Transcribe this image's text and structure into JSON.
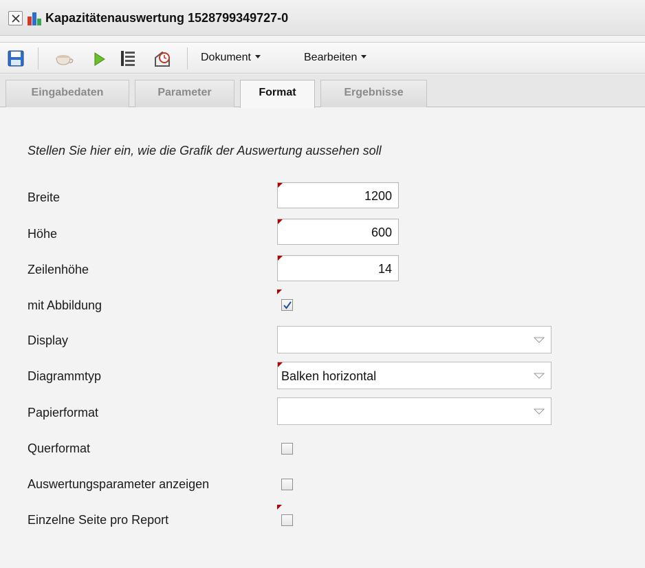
{
  "window": {
    "title": "Kapazitätenauswertung 1528799349727-0"
  },
  "toolbar": {
    "menus": [
      "Dokument",
      "Bearbeiten"
    ]
  },
  "tabs": [
    {
      "label": "Eingabedaten"
    },
    {
      "label": "Parameter"
    },
    {
      "label": "Format"
    },
    {
      "label": "Ergebnisse"
    }
  ],
  "active_tab": "Format",
  "form": {
    "intro": "Stellen Sie hier ein, wie die Grafik der Auswertung aussehen soll",
    "breite": {
      "label": "Breite",
      "value": "1200"
    },
    "hoehe": {
      "label": "Höhe",
      "value": "600"
    },
    "zeilenhoehe": {
      "label": "Zeilenhöhe",
      "value": "14"
    },
    "mit_abbildung": {
      "label": "mit Abbildung",
      "checked": true
    },
    "display": {
      "label": "Display",
      "value": ""
    },
    "diagrammtyp": {
      "label": "Diagrammtyp",
      "value": "Balken horizontal"
    },
    "papierformat": {
      "label": "Papierformat",
      "value": ""
    },
    "querformat": {
      "label": "Querformat",
      "checked": false
    },
    "auswertungsparameter": {
      "label": "Auswertungsparameter anzeigen",
      "checked": false
    },
    "einzelne_seite": {
      "label": "Einzelne Seite pro Report",
      "checked": false
    }
  },
  "colors": {
    "accent_marker": "#b50000",
    "checkmark": "#1b4fa0"
  },
  "icons": [
    "close-icon",
    "chart-icon",
    "save-icon",
    "coffee-icon",
    "run-icon",
    "list-icon",
    "timer-icon"
  ]
}
